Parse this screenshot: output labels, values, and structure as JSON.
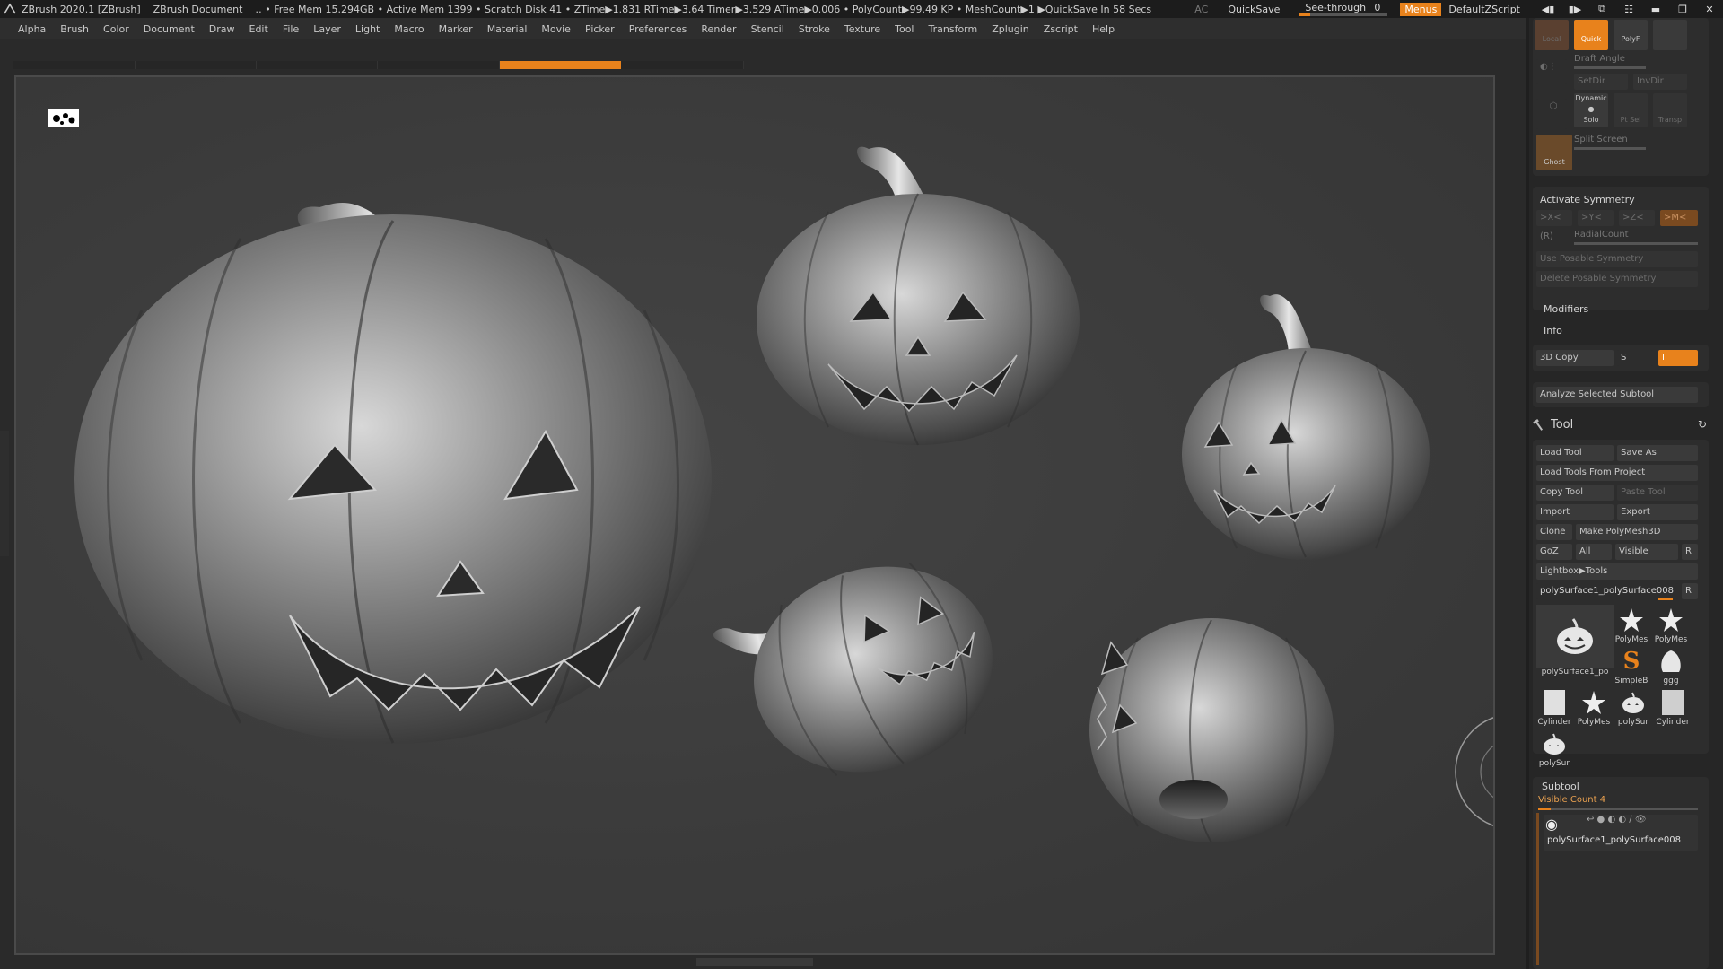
{
  "titlebar": {
    "app_title": "ZBrush 2020.1 [ZBrush]",
    "document": "ZBrush Document",
    "stats": "‥ • Free Mem 15.294GB • Active Mem 1399 • Scratch Disk 41 •  ZTime▶1.831 RTime▶3.64 Timer▶3.529 ATime▶0.006 • PolyCount▶99.49 KP  • MeshCount▶1  ▶QuickSave In 58 Secs",
    "ac": "AC",
    "quicksave": "QuickSave",
    "seethrough_label": "See-through",
    "seethrough_value": "0",
    "seethrough_level": 0,
    "menus": "Menus",
    "default_script": "DefaultZScript"
  },
  "menubar": [
    "Alpha",
    "Brush",
    "Color",
    "Document",
    "Draw",
    "Edit",
    "File",
    "Layer",
    "Light",
    "Macro",
    "Marker",
    "Material",
    "Movie",
    "Picker",
    "Preferences",
    "Render",
    "Stencil",
    "Stroke",
    "Texture",
    "Tool",
    "Transform",
    "Zplugin",
    "Zscript",
    "Help"
  ],
  "top_shelf": {
    "local": "Local",
    "quick": "Quick",
    "polyf": "PolyF",
    "draft_angle": "Draft Angle",
    "setdir": "SetDir",
    "invdir": "InvDir",
    "dynamic": "Dynamic",
    "solo": "Solo",
    "ptsel": "Pt Sel",
    "transp": "Transp",
    "ghost": "Ghost",
    "split_screen": "Split Screen"
  },
  "symmetry": {
    "activate": "Activate Symmetry",
    "x": ">X<",
    "y": ">Y<",
    "z": ">Z<",
    "m": ">M<",
    "r": "(R)",
    "radialcount": "RadialCount",
    "use_posable": "Use Posable Symmetry",
    "delete_posable": "Delete Posable Symmetry"
  },
  "panels": {
    "modifiers": "Modifiers",
    "info": "Info",
    "copy3d": "3D Copy",
    "s": "S",
    "i": "I",
    "analyze": "Analyze Selected Subtool"
  },
  "tool": {
    "title": "Tool",
    "load_tool": "Load Tool",
    "save_as": "Save As",
    "load_from_project": "Load Tools From Project",
    "copy_tool": "Copy Tool",
    "paste_tool": "Paste Tool",
    "import": "Import",
    "export": "Export",
    "clone": "Clone",
    "make_polymesh": "Make PolyMesh3D",
    "goz": "GoZ",
    "all": "All",
    "visible": "Visible",
    "r": "R",
    "lightbox": "Lightbox▶Tools",
    "current_tool": "polySurface1_polySurface008",
    "tiles": [
      {
        "label": "polySurface1_po",
        "icon": "pumpkin-icon"
      },
      {
        "label": "PolyMes",
        "icon": "star-icon"
      },
      {
        "label": "PolyMes",
        "icon": "star-icon"
      },
      {
        "label": "SimpleB",
        "icon": "simplebrush-icon"
      },
      {
        "label": "ggg",
        "icon": "blob-icon"
      },
      {
        "label": "Cylinder",
        "icon": "cylinder-icon"
      },
      {
        "label": "PolyMes",
        "icon": "star-icon"
      },
      {
        "label": "polySur",
        "icon": "pumpkin-icon"
      },
      {
        "label": "Cylinder",
        "icon": "cylinder-icon"
      },
      {
        "label": "polySur",
        "icon": "pumpkin-icon"
      }
    ]
  },
  "subtool": {
    "title": "Subtool",
    "visible_count": "Visible Count 4",
    "item": "polySurface1_polySurface008"
  },
  "colors": {
    "accent": "#e8821c",
    "background": "#2a2a2a",
    "canvas": "#3b3b3b"
  }
}
